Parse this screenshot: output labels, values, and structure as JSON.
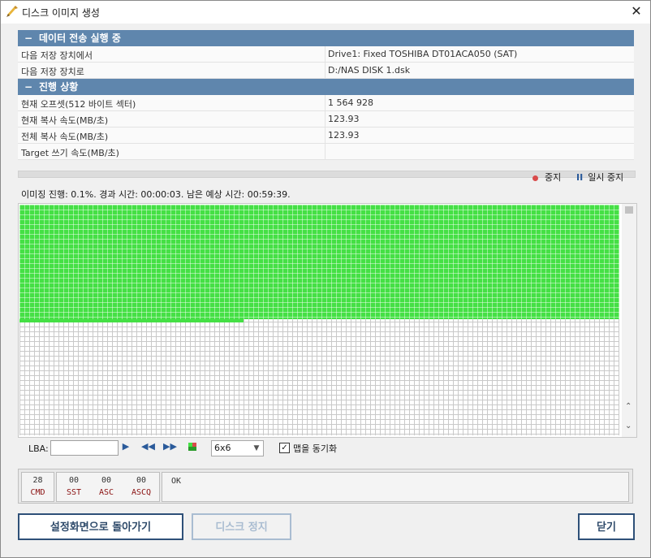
{
  "window": {
    "title": "디스크 이미지 생성",
    "close_glyph": "✕"
  },
  "section1": {
    "title": "데이터 전송 실행 중",
    "toggle": "−",
    "rows": [
      {
        "label": "다음 저장 장치에서",
        "value": "Drive1: Fixed TOSHIBA DT01ACA050 (SAT)"
      },
      {
        "label": "다음 저장 장치로",
        "value": "D:/NAS DISK 1.dsk"
      }
    ]
  },
  "section2": {
    "title": "진행 상황",
    "toggle": "−",
    "rows": [
      {
        "label": "현재 오프셋(512 바이트 섹터)",
        "value": "1 564 928"
      },
      {
        "label": "현재 복사 속도(MB/초)",
        "value": "123.93"
      },
      {
        "label": "전체 복사 속도(MB/초)",
        "value": "123.93"
      },
      {
        "label": "Target 쓰기 속도(MB/초)",
        "value": ""
      }
    ]
  },
  "controls": {
    "stop_label": "중지",
    "pause_label": "일시 중지",
    "pause_glyph": "II",
    "stop_color": "#d94b4b"
  },
  "status_line": "이미징 진행: 0.1%. 경과 시간: 00:00:03. 남은 예상 시간: 00:59:39.",
  "progress_fraction": 0.001,
  "map": {
    "done_color": "#45e045",
    "empty_color": "#ffffff"
  },
  "lba": {
    "label": "LBA:",
    "value": ""
  },
  "map_nav": {
    "play": "▶",
    "rewind": "◀◀",
    "fast_forward": "▶▶"
  },
  "map_size": {
    "selected": "6x6",
    "arrow": "▼"
  },
  "sync": {
    "checked": true,
    "check_glyph": "✓",
    "label": "맵을 동기화"
  },
  "ata_status": {
    "cmd": {
      "value": "28",
      "label": "CMD"
    },
    "sst": {
      "value": "00",
      "label": "SST"
    },
    "asc": {
      "value": "00",
      "label": "ASC"
    },
    "ascq": {
      "value": "00",
      "label": "ASCQ"
    },
    "result": "OK"
  },
  "buttons": {
    "back": "설정화면으로 돌아가기",
    "stop_disk": "디스크 정지",
    "close": "닫기"
  }
}
